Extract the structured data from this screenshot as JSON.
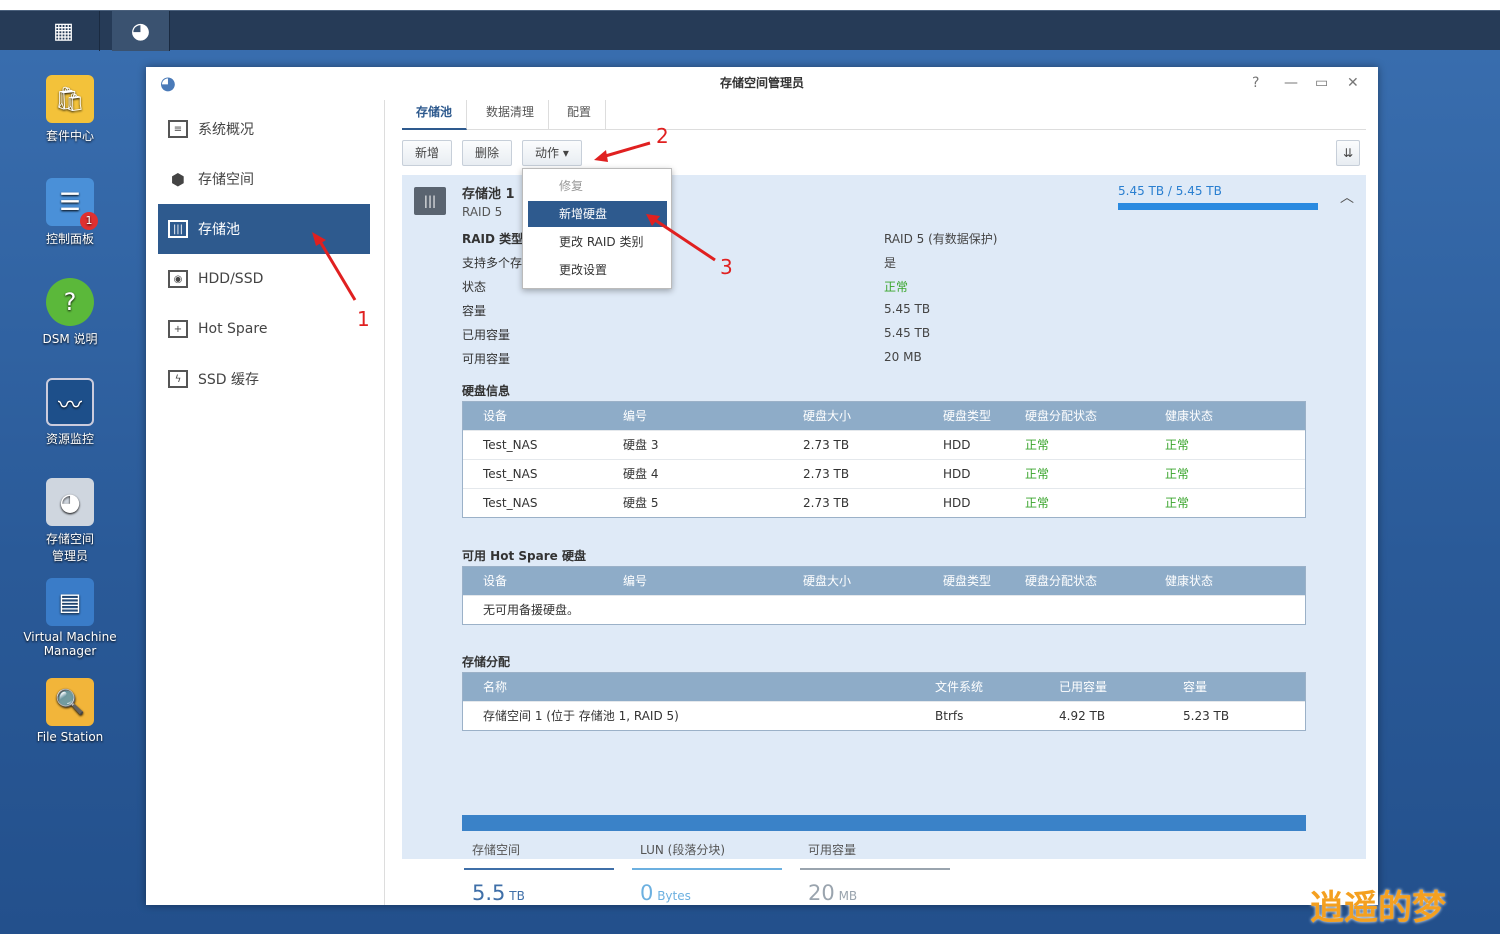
{
  "desktop": {
    "icons": [
      "套件中心",
      "控制面板",
      "DSM 说明",
      "资源监控",
      "存储空间\n管理员",
      "Virtual Machine Manager",
      "File Station"
    ],
    "badge": "1"
  },
  "window": {
    "title": "存储空间管理员",
    "help": "?",
    "minimize": "—",
    "maximize": "▭",
    "close": "✕"
  },
  "sidebar": {
    "items": [
      "系统概况",
      "存储空间",
      "存储池",
      "HDD/SSD",
      "Hot Spare",
      "SSD 缓存"
    ],
    "active": "存储池"
  },
  "tabs": [
    "存储池",
    "数据清理",
    "配置"
  ],
  "toolbar": {
    "add": "新增",
    "delete": "删除",
    "action": "动作 ▾"
  },
  "action_menu": [
    "修复",
    "新增硬盘",
    "更改 RAID 类别",
    "更改设置"
  ],
  "pool": {
    "name": "存储池 1",
    "raid": "RAID 5",
    "usage": "5.45 TB / 5.45 TB",
    "usage_fraction": 1.0,
    "props": [
      [
        "RAID 类型",
        "RAID 5 (有数据保护)"
      ],
      [
        "支持多个存储空间",
        "是"
      ],
      [
        "状态",
        "正常"
      ],
      [
        "容量",
        "5.45 TB"
      ],
      [
        "已用容量",
        "5.45 TB"
      ],
      [
        "可用容量",
        "20 MB"
      ]
    ]
  },
  "disk_info": {
    "title": "硬盘信息",
    "headers": [
      "设备",
      "编号",
      "硬盘大小",
      "硬盘类型",
      "硬盘分配状态",
      "健康状态"
    ],
    "rows": [
      [
        "Test_NAS",
        "硬盘 3",
        "2.73 TB",
        "HDD",
        "正常",
        "正常"
      ],
      [
        "Test_NAS",
        "硬盘 4",
        "2.73 TB",
        "HDD",
        "正常",
        "正常"
      ],
      [
        "Test_NAS",
        "硬盘 5",
        "2.73 TB",
        "HDD",
        "正常",
        "正常"
      ]
    ]
  },
  "hot_spare": {
    "title": "可用 Hot Spare 硬盘",
    "headers": [
      "设备",
      "编号",
      "硬盘大小",
      "硬盘类型",
      "硬盘分配状态",
      "健康状态"
    ],
    "empty": "无可用备援硬盘。"
  },
  "allocation": {
    "title": "存储分配",
    "headers": [
      "名称",
      "文件系统",
      "已用容量",
      "容量"
    ],
    "rows": [
      [
        "存储空间 1 (位于 存储池 1, RAID 5)",
        "Btrfs",
        "4.92 TB",
        "5.23 TB"
      ]
    ]
  },
  "summary": [
    {
      "label": "存储空间",
      "value": "5.5",
      "unit": "TB",
      "color": "#3f6fa8"
    },
    {
      "label": "LUN (段落分块)",
      "value": "0",
      "unit": "Bytes",
      "color": "#6cb0e0"
    },
    {
      "label": "可用容量",
      "value": "20",
      "unit": "MB",
      "color": "#9aa4ae"
    }
  ],
  "annotations": [
    "1",
    "2",
    "3"
  ],
  "watermark": "逍遥的梦"
}
